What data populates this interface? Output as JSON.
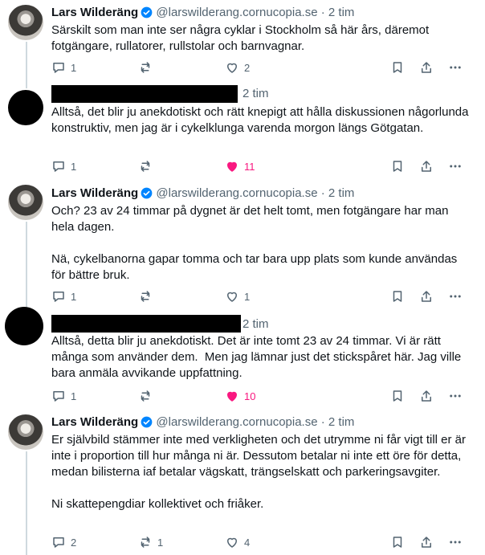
{
  "posts": [
    {
      "author_name": "Lars Wilderäng",
      "handle": "@larswilderang.cornucopia.se",
      "time": "2 tim",
      "text": "Särskilt som man inte ser några cyklar i Stockholm så här års, däremot fotgängare, rullatorer, rullstolar och barnvagnar.",
      "replies": "1",
      "reposts": "",
      "likes": "2",
      "liked": false
    },
    {
      "author_name": "",
      "handle": "",
      "time": "2 tim",
      "text": "Alltså, det blir ju anekdotiskt och rätt knepigt att hålla diskussionen någorlunda konstruktiv, men jag är i cykelklunga varenda morgon längs Götgatan.",
      "replies": "1",
      "reposts": "",
      "likes": "11",
      "liked": true
    },
    {
      "author_name": "Lars Wilderäng",
      "handle": "@larswilderang.cornucopia.se",
      "time": "2 tim",
      "text": "Och? 23 av 24 timmar på dygnet är det helt tomt, men fotgängare har man hela dagen.\n\nNä, cykelbanorna gapar tomma och tar bara upp plats som kunde användas för bättre bruk.",
      "replies": "1",
      "reposts": "",
      "likes": "1",
      "liked": false
    },
    {
      "author_name": "",
      "handle": "",
      "time": "2 tim",
      "text": "Alltså, detta blir ju anekdotiskt. Det är inte tomt 23 av 24 timmar. Vi är rätt många som använder dem.  Men jag lämnar just det stickspåret här. Jag ville bara anmäla avvikande uppfattning.",
      "replies": "1",
      "reposts": "",
      "likes": "10",
      "liked": true
    },
    {
      "author_name": "Lars Wilderäng",
      "handle": "@larswilderang.cornucopia.se",
      "time": "2 tim",
      "text": "Er självbild stämmer inte med verkligheten och det utrymme ni får vigt till er är inte i proportion till hur många ni är. Dessutom betalar ni inte ett öre för detta, medan bilisterna iaf betalar vägskatt, trängselskatt och parkeringsavgiter.\n\nNi skattepengdiar kollektivet och friåker.",
      "replies": "2",
      "reposts": "1",
      "likes": "4",
      "liked": false
    }
  ],
  "separator": "·",
  "colors": {
    "muted": "#536471",
    "like": "#f91880",
    "verified": "#0085ff",
    "text": "#0f1419"
  },
  "icons": [
    "reply-icon",
    "repost-icon",
    "like-icon",
    "bookmark-icon",
    "share-icon",
    "more-icon",
    "verified-icon"
  ]
}
